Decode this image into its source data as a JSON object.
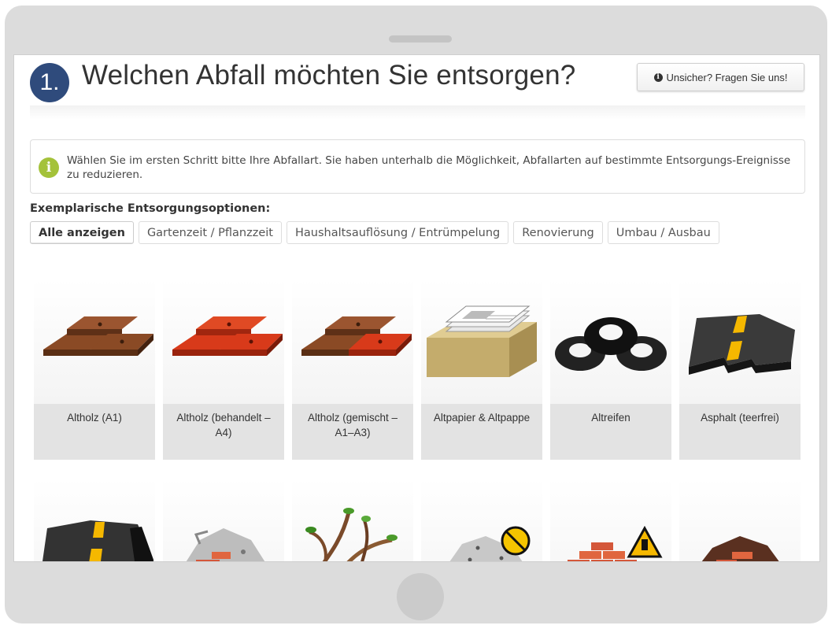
{
  "header": {
    "step_number": "1.",
    "title": "Welchen Abfall möchten Sie entsorgen?",
    "help_button": "Unsicher? Fragen Sie uns!"
  },
  "info": {
    "text": "Wählen Sie im ersten Schritt bitte Ihre Abfallart. Sie haben unterhalb die Möglichkeit, Abfallarten auf bestimmte Entsorgungs-Ereignisse zu reduzieren."
  },
  "options": {
    "label": "Exemplarische Entsorgungsoptionen:",
    "filters": [
      {
        "label": "Alle anzeigen",
        "active": true
      },
      {
        "label": "Gartenzeit / Pflanzzeit",
        "active": false
      },
      {
        "label": "Haushaltsauflösung / Entrümpelung",
        "active": false
      },
      {
        "label": "Renovierung",
        "active": false
      },
      {
        "label": "Umbau / Ausbau",
        "active": false
      }
    ]
  },
  "waste_types": [
    {
      "label": "Altholz (A1)",
      "icon": "wood-planks-brown-icon"
    },
    {
      "label": "Altholz (behandelt – A4)",
      "icon": "wood-planks-red-icon"
    },
    {
      "label": "Altholz (gemischt – A1–A3)",
      "icon": "wood-planks-mixed-icon"
    },
    {
      "label": "Altpapier & Altpappe",
      "icon": "paper-box-icon"
    },
    {
      "label": "Altreifen",
      "icon": "tires-icon"
    },
    {
      "label": "Asphalt (teerfrei)",
      "icon": "asphalt-road-icon"
    },
    {
      "label": "",
      "icon": "asphalt-tar-icon"
    },
    {
      "label": "",
      "icon": "rubble-mixed-icon"
    },
    {
      "label": "",
      "icon": "green-waste-branches-icon"
    },
    {
      "label": "",
      "icon": "gravel-hazard-icon"
    },
    {
      "label": "",
      "icon": "bricks-hazard-icon"
    },
    {
      "label": "",
      "icon": "soil-bricks-icon"
    }
  ],
  "colors": {
    "step_badge": "#2f4b7c",
    "info_icon": "#a4c23a",
    "label_bg": "#e3e3e3"
  }
}
